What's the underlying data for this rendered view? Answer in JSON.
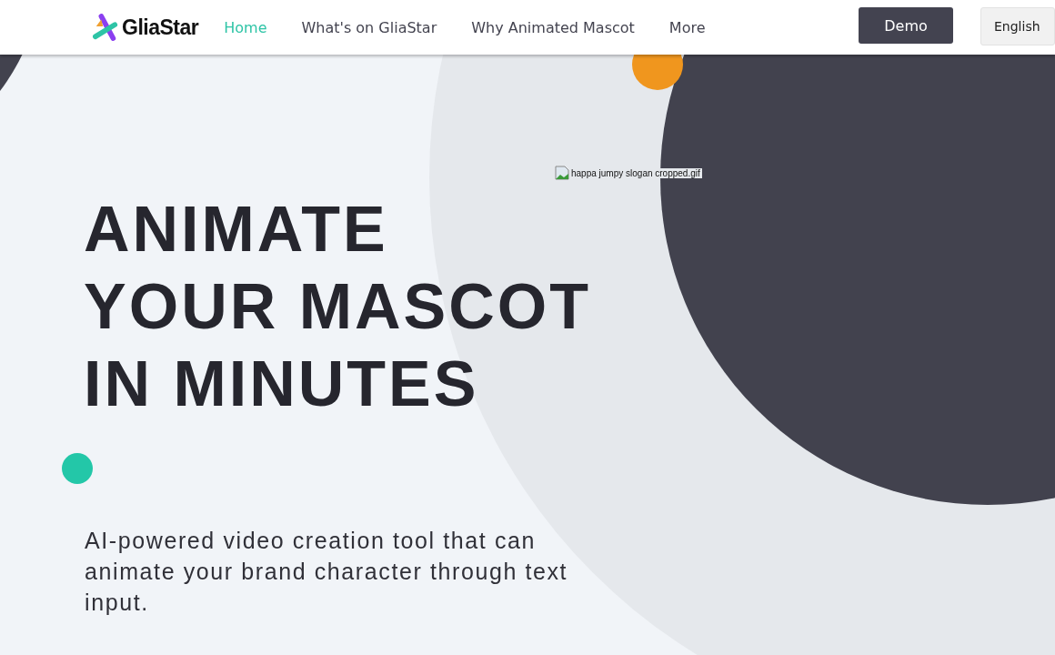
{
  "header": {
    "logo": {
      "text": "GliaStar"
    },
    "nav": [
      {
        "label": "Home",
        "selected": true
      },
      {
        "label": "What's on GliaStar",
        "selected": false
      },
      {
        "label": "Why Animated Mascot",
        "selected": false
      },
      {
        "label": "More",
        "selected": false
      }
    ],
    "demo_button": "Demo",
    "language_button": "English"
  },
  "hero": {
    "image_alt": "happa jumpy slogan cropped.gif",
    "headline": [
      "ANIMATE",
      "YOUR MASCOT",
      "IN MINUTES"
    ],
    "subtitle": "AI-powered video creation tool that can animate your brand character through text input."
  }
}
